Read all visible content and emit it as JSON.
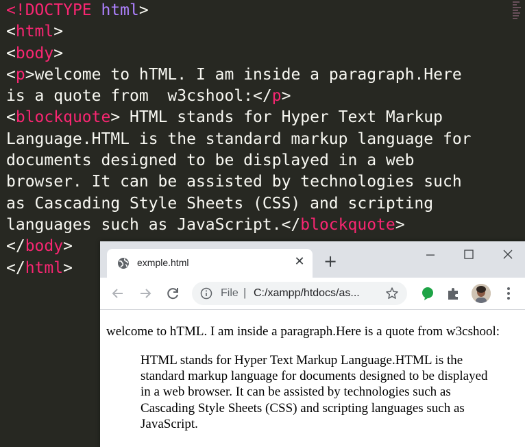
{
  "editor": {
    "lines": [
      [
        {
          "t": "<!",
          "c": "tag"
        },
        {
          "t": "DOCTYPE",
          "c": "tag"
        },
        {
          "t": " html",
          "c": "kw"
        },
        {
          "t": ">",
          "c": "txt"
        }
      ],
      [
        {
          "t": "<",
          "c": "txt"
        },
        {
          "t": "html",
          "c": "tag"
        },
        {
          "t": ">",
          "c": "txt"
        }
      ],
      [
        {
          "t": "<",
          "c": "txt"
        },
        {
          "t": "body",
          "c": "tag"
        },
        {
          "t": ">",
          "c": "txt"
        }
      ],
      [
        {
          "t": "<",
          "c": "txt"
        },
        {
          "t": "p",
          "c": "tag"
        },
        {
          "t": ">welcome to hTML. I am inside a paragraph.Here",
          "c": "txt"
        }
      ],
      [
        {
          "t": "is a quote from  w3cshool:</",
          "c": "txt"
        },
        {
          "t": "p",
          "c": "tag"
        },
        {
          "t": ">",
          "c": "txt"
        }
      ],
      [
        {
          "t": "<",
          "c": "txt"
        },
        {
          "t": "blockquote",
          "c": "tag"
        },
        {
          "t": "> HTML stands for Hyper Text Markup",
          "c": "txt"
        }
      ],
      [
        {
          "t": "Language.HTML is the standard markup language for",
          "c": "txt"
        }
      ],
      [
        {
          "t": "documents designed to be displayed in a web",
          "c": "txt"
        }
      ],
      [
        {
          "t": "browser. It can be assisted by technologies such",
          "c": "txt"
        }
      ],
      [
        {
          "t": "as Cascading Style Sheets (CSS) and scripting",
          "c": "txt"
        }
      ],
      [
        {
          "t": "languages such as JavaScript.</",
          "c": "txt"
        },
        {
          "t": "blockquote",
          "c": "tag"
        },
        {
          "t": ">",
          "c": "txt"
        }
      ],
      [
        {
          "t": "</",
          "c": "txt"
        },
        {
          "t": "body",
          "c": "tag"
        },
        {
          "t": ">",
          "c": "txt"
        }
      ],
      [
        {
          "t": "</",
          "c": "txt"
        },
        {
          "t": "html",
          "c": "tag"
        },
        {
          "t": ">",
          "c": "txt"
        }
      ]
    ],
    "colors": {
      "background": "#272822",
      "text": "#f8f8f2",
      "tag": "#f92672",
      "keyword": "#ae81ff"
    }
  },
  "browser": {
    "tab": {
      "title": "exmple.html",
      "icon": "globe-icon",
      "close_icon": "close-icon"
    },
    "new_tab_icon": "plus-icon",
    "window_controls": {
      "minimize": "minimize-icon",
      "maximize": "maximize-icon",
      "close": "close-icon"
    },
    "toolbar": {
      "back_icon": "back-arrow-icon",
      "forward_icon": "forward-arrow-icon",
      "reload_icon": "reload-icon",
      "info_icon": "info-icon",
      "scheme_label": "File",
      "separator": "|",
      "url": "C:/xampp/htdocs/as...",
      "bookmark_icon": "star-icon",
      "extension_icons": [
        "green-extension-icon",
        "puzzle-extension-icon"
      ],
      "avatar": "profile-avatar",
      "menu_icon": "kebab-menu-icon"
    },
    "page": {
      "paragraph": "welcome to hTML. I am inside a paragraph.Here is a quote from w3cshool:",
      "blockquote": "HTML stands for Hyper Text Markup Language.HTML is the standard markup language for documents designed to be displayed in a web browser. It can be assisted by technologies such as Cascading Style Sheets (CSS) and scripting languages such as JavaScript."
    }
  }
}
